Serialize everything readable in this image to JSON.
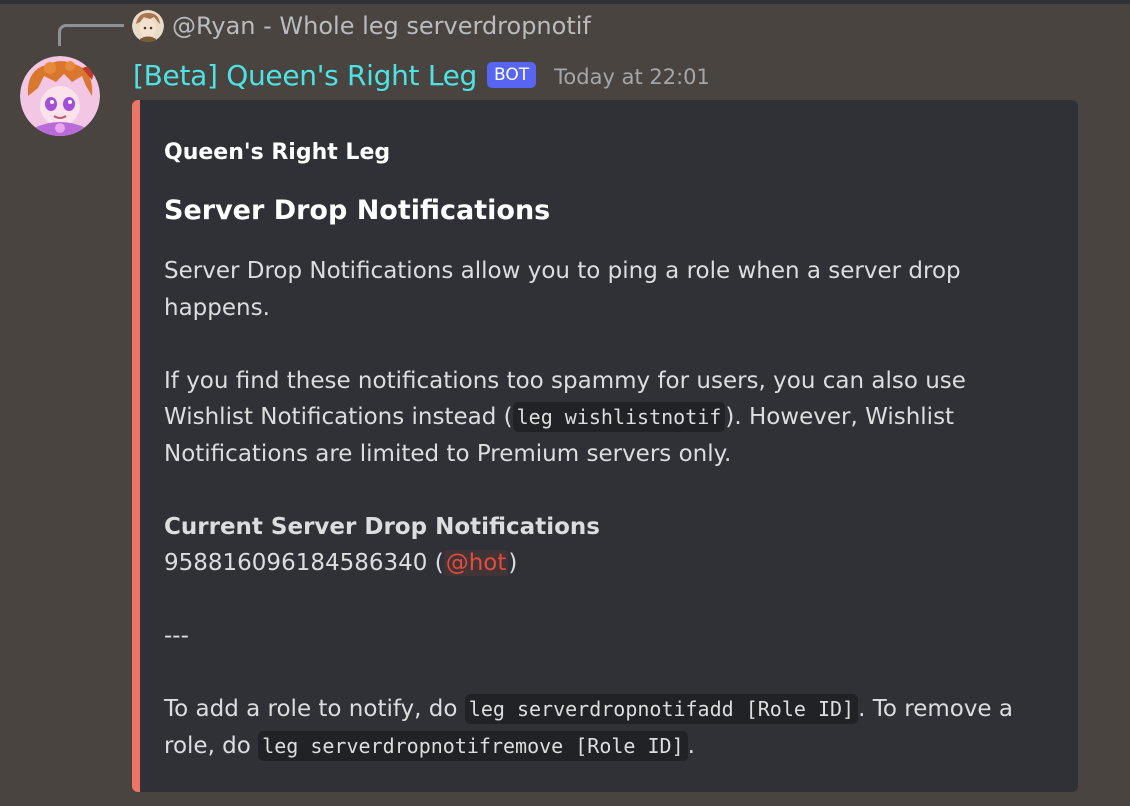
{
  "reply": {
    "author": "@Ryan",
    "separator": " - ",
    "content": "Whole leg serverdropnotif"
  },
  "message": {
    "username": "[Beta] Queen's Right Leg",
    "bot_tag": "BOT",
    "timestamp": "Today at 22:01"
  },
  "embed": {
    "accent_color": "#ed7565",
    "author": "Queen's Right Leg",
    "title": "Server Drop Notifications",
    "p1": "Server Drop Notifications allow you to ping a role when a server drop happens.",
    "p2_start": "If you find these notifications too spammy for users, you can also use Wishlist Notifications instead (",
    "p2_code": "leg wishlistnotif",
    "p2_end": "). However, Wishlist Notifications are limited to Premium servers only.",
    "current_heading": "Current Server Drop Notifications",
    "role_id": "958816096184586340",
    "role_open": " (",
    "role_mention": "@hot",
    "role_close": ")",
    "divider": "---",
    "p4_start": "To add a role to notify, do ",
    "p4_code1": "leg serverdropnotifadd [Role ID]",
    "p4_mid": ". To remove a role, do ",
    "p4_code2": "leg serverdropnotifremove [Role ID]",
    "p4_end": "."
  },
  "colors": {
    "background": "#49443f",
    "embed_background": "#2f3136",
    "username": "#4ee2e4",
    "bot_tag": "#5865f2",
    "mention": "#e34b3c"
  }
}
